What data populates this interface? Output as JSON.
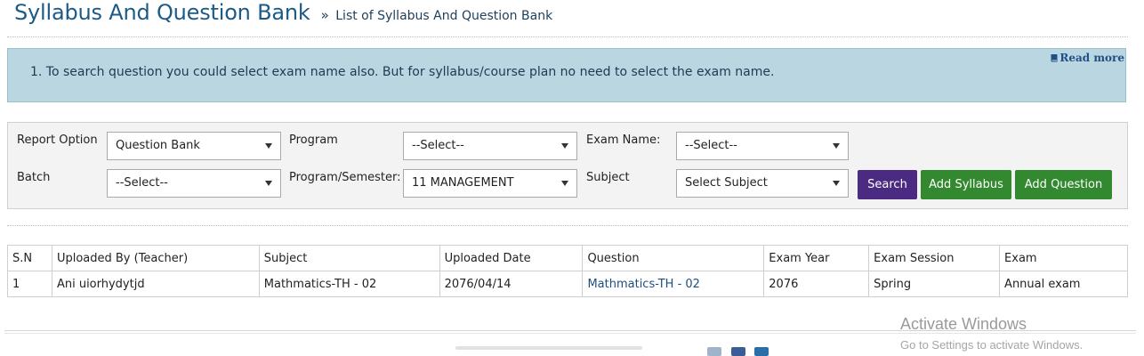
{
  "header": {
    "title": "Syllabus And Question Bank",
    "breadcrumb_sep": "»",
    "breadcrumb": "List of Syllabus And Question Bank"
  },
  "info": {
    "text": "1. To search question you could select exam name also. But for syllabus/course plan no need to select the exam name.",
    "read_more": "Read more",
    "read_more_icon": "book-icon"
  },
  "filters": {
    "report_option": {
      "label": "Report Option",
      "value": "Question Bank"
    },
    "program": {
      "label": "Program",
      "value": "--Select--"
    },
    "exam_name": {
      "label": "Exam Name:",
      "value": "--Select--"
    },
    "batch": {
      "label": "Batch",
      "value": "--Select--"
    },
    "program_semester": {
      "label": "Program/Semester:",
      "value": "11 MANAGEMENT"
    },
    "subject": {
      "label": "Subject",
      "value": "Select Subject"
    }
  },
  "buttons": {
    "search": "Search",
    "add_syllabus": "Add Syllabus",
    "add_question": "Add Question"
  },
  "table": {
    "headers": [
      "S.N",
      "Uploaded By (Teacher)",
      "Subject",
      "Uploaded Date",
      "Question",
      "Exam Year",
      "Exam Session",
      "Exam"
    ],
    "rows": [
      [
        "1",
        "Ani uiorhydytjd",
        "Mathmatics-TH - 02",
        "2076/04/14",
        "Mathmatics-TH - 02",
        "2076",
        "Spring",
        "Annual exam"
      ]
    ]
  },
  "watermark": {
    "title": "Activate Windows",
    "subtitle": "Go to Settings to activate Windows."
  },
  "colors": {
    "title": "#1c5a87",
    "info_bg": "#b9d6e1",
    "search_btn": "#4b2a82",
    "green_btn": "#33892f",
    "link": "#1d4e80"
  }
}
